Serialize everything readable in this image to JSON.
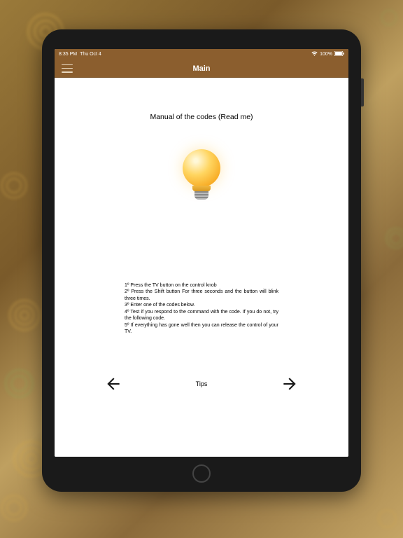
{
  "status": {
    "time": "8:35 PM",
    "date": "Thu Oct 4",
    "battery": "100%"
  },
  "nav": {
    "title": "Main"
  },
  "page": {
    "title": "Manual of the codes (Read me)"
  },
  "instructions": {
    "line1": "1º Press the TV button on the control knob",
    "line2": "2º Press the Shift button For three seconds and the button will blink three times.",
    "line3": "3º Enter one of the codes below.",
    "line4": "4º Test if you respond to the command with the code. If you do not, try the following code.",
    "line5": "5º If everything has gone well then you can release the control of your TV."
  },
  "footer": {
    "label": "Tips"
  }
}
